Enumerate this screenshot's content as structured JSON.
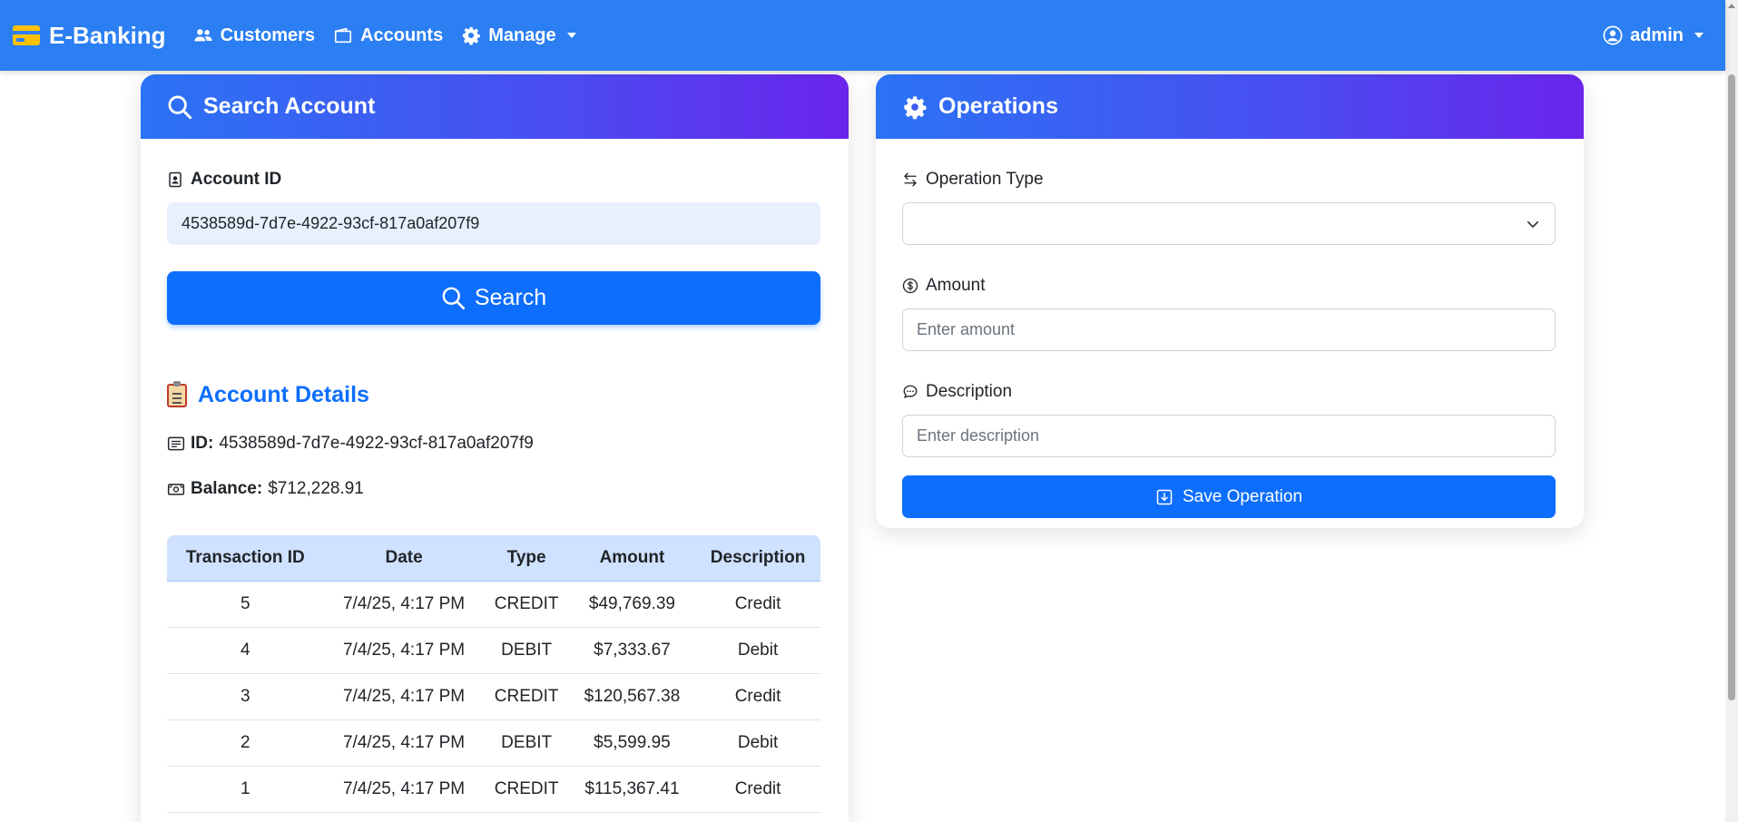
{
  "navbar": {
    "brand": "E-Banking",
    "items": [
      {
        "label": "Customers"
      },
      {
        "label": "Accounts"
      },
      {
        "label": "Manage"
      }
    ],
    "user": "admin"
  },
  "search_card": {
    "title": "Search Account",
    "account_id_label": "Account ID",
    "account_id_value": "4538589d-7d7e-4922-93cf-817a0af207f9",
    "search_button": "Search"
  },
  "details": {
    "title": "Account Details",
    "id_label": "ID:",
    "id_value": "4538589d-7d7e-4922-93cf-817a0af207f9",
    "balance_label": "Balance:",
    "balance_value": "$712,228.91"
  },
  "transactions": {
    "columns": [
      "Transaction ID",
      "Date",
      "Type",
      "Amount",
      "Description"
    ],
    "rows": [
      {
        "id": "5",
        "date": "7/4/25, 4:17 PM",
        "type": "CREDIT",
        "amount": "$49,769.39",
        "description": "Credit"
      },
      {
        "id": "4",
        "date": "7/4/25, 4:17 PM",
        "type": "DEBIT",
        "amount": "$7,333.67",
        "description": "Debit"
      },
      {
        "id": "3",
        "date": "7/4/25, 4:17 PM",
        "type": "CREDIT",
        "amount": "$120,567.38",
        "description": "Credit"
      },
      {
        "id": "2",
        "date": "7/4/25, 4:17 PM",
        "type": "DEBIT",
        "amount": "$5,599.95",
        "description": "Debit"
      },
      {
        "id": "1",
        "date": "7/4/25, 4:17 PM",
        "type": "CREDIT",
        "amount": "$115,367.41",
        "description": "Credit"
      }
    ]
  },
  "operations": {
    "title": "Operations",
    "type_label": "Operation Type",
    "type_value": "",
    "amount_label": "Amount",
    "amount_placeholder": "Enter amount",
    "description_label": "Description",
    "description_placeholder": "Enter description",
    "save_button": "Save Operation"
  },
  "colors": {
    "navbar": "#2b7ff2",
    "primary": "#0d6efd",
    "header_gradient_start": "#2b73f5",
    "header_gradient_end": "#6a24ec",
    "table_header": "#cfe2ff"
  }
}
